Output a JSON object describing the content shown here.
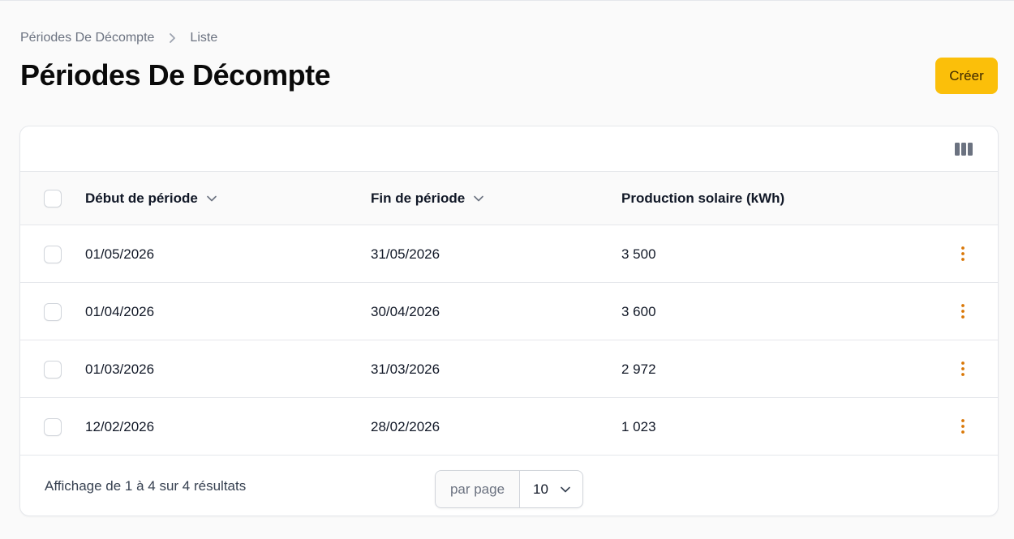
{
  "breadcrumb": {
    "parent": "Périodes De Décompte",
    "current": "Liste"
  },
  "page": {
    "title": "Périodes De Décompte",
    "create_label": "Créer"
  },
  "table": {
    "columns": {
      "start": "Début de période",
      "end": "Fin de période",
      "production": "Production solaire (kWh)"
    },
    "rows": [
      {
        "start": "01/05/2026",
        "end": "31/05/2026",
        "production": "3 500"
      },
      {
        "start": "01/04/2026",
        "end": "30/04/2026",
        "production": "3 600"
      },
      {
        "start": "01/03/2026",
        "end": "31/03/2026",
        "production": "2 972"
      },
      {
        "start": "12/02/2026",
        "end": "28/02/2026",
        "production": "1 023"
      }
    ]
  },
  "footer": {
    "summary": "Affichage de 1 à 4 sur 4 résultats",
    "per_page_label": "par page",
    "per_page_value": "10"
  },
  "icons": {
    "breadcrumb_separator": "chevron-right-icon",
    "sort": "chevron-down-icon",
    "columns": "columns-icon",
    "row_actions": "ellipsis-vertical-icon"
  },
  "colors": {
    "accent": "#fbbf0a",
    "action_icon": "#d97706",
    "background": "#fafafa",
    "border": "#e5e7eb"
  }
}
